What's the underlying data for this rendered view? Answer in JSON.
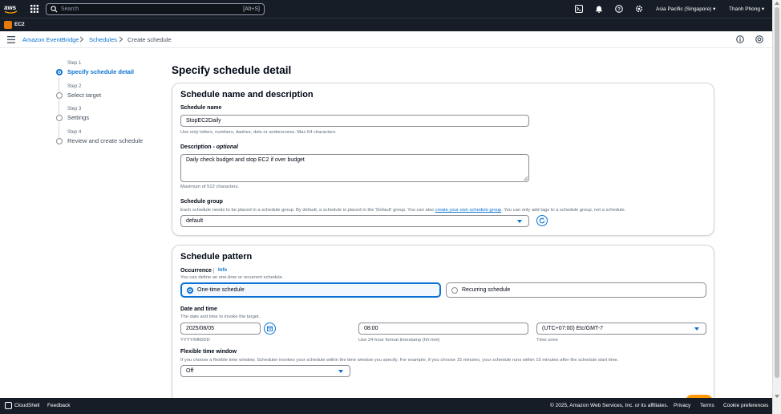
{
  "topbar": {
    "search_placeholder": "Search",
    "search_shortcut": "[Alt+S]",
    "region": "Asia Pacific (Singapore)",
    "user": "Thanh Phong"
  },
  "servicebar": {
    "service": "EC2"
  },
  "breadcrumb": {
    "items": [
      "Amazon EventBridge",
      "Schedules",
      "Create schedule"
    ]
  },
  "steps": [
    {
      "num": "Step 1",
      "label": "Specify schedule detail",
      "active": true
    },
    {
      "num": "Step 2",
      "label": "Select target",
      "active": false
    },
    {
      "num": "Step 3",
      "label": "Settings",
      "active": false
    },
    {
      "num": "Step 4",
      "label": "Review and create schedule",
      "active": false
    }
  ],
  "page": {
    "title": "Specify schedule detail"
  },
  "name_panel": {
    "title": "Schedule name and description",
    "name_label": "Schedule name",
    "name_value": "StopEC2Daily",
    "name_hint": "Use only letters, numbers, dashes, dots or underscores. Max 64 characters.",
    "desc_label": "Description - ",
    "desc_optional": "optional",
    "desc_value": "Daily check budget and stop EC2 if over budget",
    "desc_hint": "Maximum of 512 characters.",
    "group_label": "Schedule group",
    "group_hint_pre": "Each schedule needs to be placed in a schedule group. By default, a schedule is placed in the 'Default' group. You can also ",
    "group_hint_link": "create your own schedule group",
    "group_hint_post": ". You can only add tags to a schedule group, not a schedule.",
    "group_value": "default"
  },
  "pattern_panel": {
    "title": "Schedule pattern",
    "occurrence_label": "Occurrence",
    "info": "Info",
    "occurrence_hint": "You can define an one-time or recurrent schedule.",
    "option_one_time": "One-time schedule",
    "option_recurring": "Recurring schedule",
    "datetime_label": "Date and time",
    "datetime_hint": "The date and time to invoke the target.",
    "date_value": "2025/08/05",
    "date_hint": "YYYY/MM/DD",
    "time_value": "08:00",
    "time_hint": "Use 24-hour format timestamp (hh:mm)",
    "tz_value": "(UTC+07:00) Etc/GMT-7",
    "tz_hint": "Time zone",
    "flex_label": "Flexible time window",
    "flex_hint": "If you choose a flexible time window, Scheduler invokes your schedule within the time window you specify. For example, if you choose 15 minutes, your schedule runs within 15 minutes after the schedule start time.",
    "flex_value": "Off"
  },
  "footer": {
    "cloudshell": "CloudShell",
    "feedback": "Feedback",
    "copyright": "© 2025, Amazon Web Services, Inc. or its affiliates.",
    "privacy": "Privacy",
    "terms": "Terms",
    "cookies": "Cookie preferences"
  },
  "colors": {
    "accent": "#0972d3",
    "nav": "#161d26",
    "ec2": "#e57a0a",
    "aws_orange": "#ff9900"
  }
}
